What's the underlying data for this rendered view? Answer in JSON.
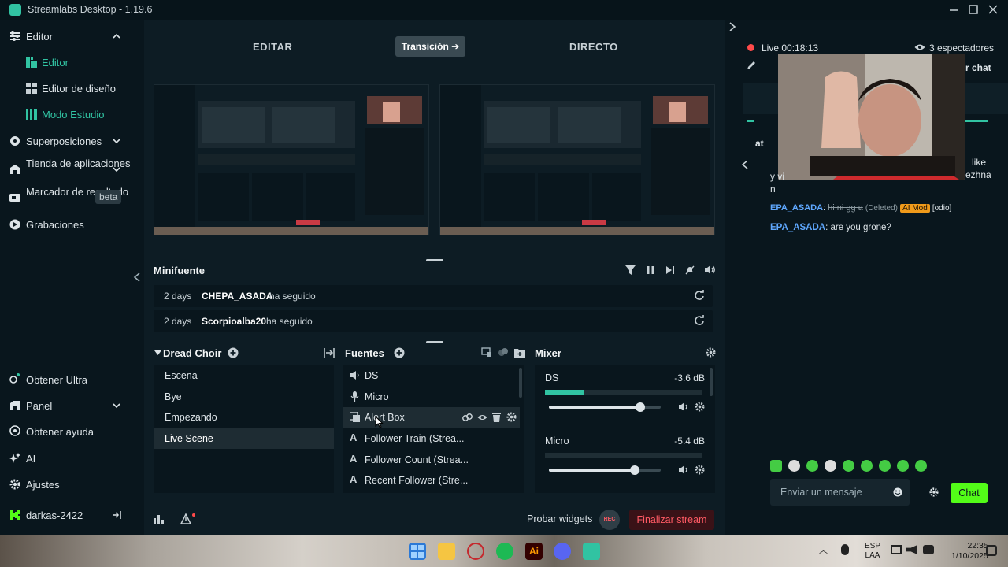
{
  "app": {
    "title": "Streamlabs Desktop - 1.19.6"
  },
  "sidebar": {
    "editor_section": "Editor",
    "editor_items": [
      "Editor",
      "Editor de diseño",
      "Modo Estudio"
    ],
    "items": [
      "Superposiciones",
      "Tienda de aplicaciones",
      "Marcador de resaltado",
      "Grabaciones"
    ],
    "beta_label": "beta",
    "bottom": [
      "Obtener Ultra",
      "Panel",
      "Obtener ayuda",
      "AI",
      "Ajustes"
    ],
    "user": "darkas-2422"
  },
  "modes": {
    "edit": "EDITAR",
    "transition": "Transición",
    "live": "DIRECTO"
  },
  "minifeed": {
    "title": "Minifuente",
    "events": [
      {
        "age": "2 days",
        "name": "CHEPA_ASADA",
        "action": "ha seguido"
      },
      {
        "age": "2 days",
        "name": "Scorpioalba20",
        "action": "ha seguido"
      }
    ]
  },
  "scenes": {
    "title": "Dread Choir",
    "items": [
      "Escena",
      "Bye",
      "Empezando",
      "Live Scene"
    ],
    "selected": "Live Scene"
  },
  "sources": {
    "title": "Fuentes",
    "items": [
      {
        "label": "DS",
        "icon": "speaker-icon"
      },
      {
        "label": "Micro",
        "icon": "mic-icon"
      },
      {
        "label": "Alert Box",
        "icon": "alert-box-icon"
      },
      {
        "label": "Follower Train (Strea...",
        "icon": "text-icon"
      },
      {
        "label": "Follower Count (Strea...",
        "icon": "text-icon"
      },
      {
        "label": "Recent Follower (Stre...",
        "icon": "text-icon"
      }
    ]
  },
  "mixer": {
    "title": "Mixer",
    "channels": [
      {
        "name": "DS",
        "db": "-3.6 dB",
        "volume": 0.82,
        "level": 0.25
      },
      {
        "name": "Micro",
        "db": "-5.4 dB",
        "volume": 0.77,
        "level": 0.0
      }
    ]
  },
  "footer": {
    "test_widgets": "Probar widgets",
    "rec": "REC",
    "end_stream": "Finalizar stream"
  },
  "chat": {
    "live_time": "Live 00:18:13",
    "viewers": "3 espectadores",
    "popout_fragment": "r chat",
    "partial_lines": [
      "at",
      "y vi",
      "n",
      "like",
      "ezhna"
    ],
    "messages": [
      {
        "user": "EPA_ASADA",
        "text": "hi ni gg a",
        "deleted": "(Deleted)",
        "badge": "AI Mod",
        "tag": "[odio]"
      },
      {
        "user": "EPA_ASADA",
        "text": "are you grone?"
      }
    ],
    "input_placeholder": "Enviar un mensaje",
    "send_label": "Chat"
  },
  "taskbar": {
    "lang1": "ESP",
    "lang2": "LAA",
    "time": "22:35",
    "date": "1/10/2025"
  },
  "colors": {
    "accent": "#31c3a2",
    "live_dot": "#ff4a4a",
    "end_stream_bg": "#3a1217",
    "end_stream_text": "#ff5a64",
    "ai_mod_badge": "#f09a1a"
  }
}
